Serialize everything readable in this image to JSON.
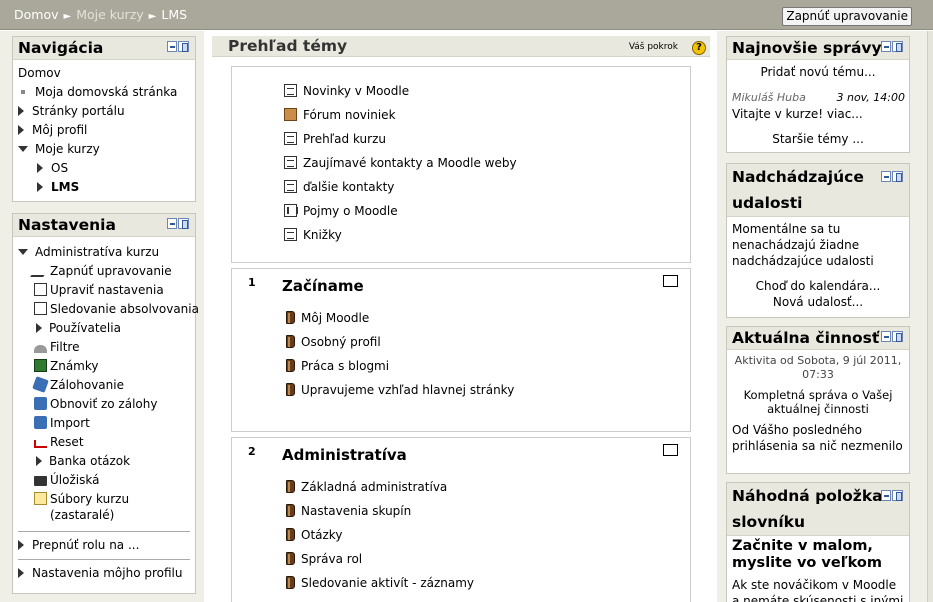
{
  "breadcrumb": {
    "home": "Domov",
    "my_courses": "Moje kurzy",
    "current": "LMS",
    "separator": "►"
  },
  "edit_button": "Zapnúť upravovanie",
  "navigation": {
    "title": "Navigácia",
    "items": [
      {
        "label": "Domov",
        "bullet": "none",
        "indent": 0,
        "bold": false
      },
      {
        "label": "Moja domovská stránka",
        "bullet": "square",
        "indent": 0,
        "bold": false
      },
      {
        "label": "Stránky portálu",
        "bullet": "collapsed",
        "indent": 0,
        "bold": false
      },
      {
        "label": "Môj profil",
        "bullet": "collapsed",
        "indent": 0,
        "bold": false
      },
      {
        "label": "Moje kurzy",
        "bullet": "expanded",
        "indent": 0,
        "bold": false
      },
      {
        "label": "OS",
        "bullet": "collapsed",
        "indent": 1,
        "bold": false
      },
      {
        "label": "LMS",
        "bullet": "collapsed",
        "indent": 1,
        "bold": true
      }
    ]
  },
  "settings": {
    "title": "Nastavenia",
    "admin_title": "Administratíva kurzu",
    "items": [
      {
        "label": "Zapnúť upravovanie",
        "icon": "edit-icon"
      },
      {
        "label": "Upraviť nastavenia",
        "icon": "settings-doc-icon"
      },
      {
        "label": "Sledovanie absolvovania",
        "icon": "completion-doc-icon"
      },
      {
        "label": "Používatelia",
        "icon": "collapsed"
      },
      {
        "label": "Filtre",
        "icon": "filter-icon"
      },
      {
        "label": "Známky",
        "icon": "grades-icon"
      },
      {
        "label": "Zálohovanie",
        "icon": "backup-icon"
      },
      {
        "label": "Obnoviť zo zálohy",
        "icon": "restore-icon"
      },
      {
        "label": "Import",
        "icon": "import-icon"
      },
      {
        "label": "Reset",
        "icon": "reset-icon"
      },
      {
        "label": "Banka otázok",
        "icon": "collapsed"
      },
      {
        "label": "Úložiská",
        "icon": "repository-icon"
      },
      {
        "label": "Súbory kurzu",
        "icon": "folder-icon"
      },
      {
        "label": "(zastaralé)",
        "icon": "none"
      }
    ],
    "switch_role": "Prepnúť rolu na ...",
    "profile_settings": "Nastavenia môjho profilu"
  },
  "main": {
    "title": "Prehľad témy",
    "progress_label": "Váš pokrok",
    "help_glyph": "?",
    "section0": [
      {
        "label": "Novinky v Moodle",
        "icon": "doc"
      },
      {
        "label": "Fórum noviniek",
        "icon": "forum"
      },
      {
        "label": "Prehľad kurzu",
        "icon": "doc"
      },
      {
        "label": "Zaujímavé kontakty a Moodle weby",
        "icon": "doc"
      },
      {
        "label": "ďalšie kontakty",
        "icon": "doc"
      },
      {
        "label": "Pojmy o Moodle",
        "icon": "glossary"
      },
      {
        "label": "Knižky",
        "icon": "doc"
      }
    ],
    "section1": {
      "number": "1",
      "title": "Začíname",
      "items": [
        "Môj Moodle",
        "Osobný profil",
        "Práca s blogmi",
        "Upravujeme vzhľad hlavnej stránky"
      ]
    },
    "section2": {
      "number": "2",
      "title": "Administratíva",
      "items": [
        "Základná administratíva",
        "Nastavenia skupín",
        "Otázky",
        "Správa rol",
        "Sledovanie aktivít - záznamy"
      ]
    }
  },
  "news": {
    "title": "Najnovšie správy",
    "add_topic": "Pridať novú tému...",
    "author": "Mikuláš Huba",
    "date": "3 nov, 14:00",
    "post": "Vitajte v kurze! viac...",
    "older": "Staršie témy ..."
  },
  "events": {
    "title_line1": "Nadchádzajúce",
    "title_line2": "udalosti",
    "text": "Momentálne sa tu nenachádzajú žiadne nadchádzajúce udalosti",
    "calendar_link": "Choď do kalendára...",
    "new_event": "Nová udalosť..."
  },
  "activity": {
    "title": "Aktuálna činnosť",
    "since": "Aktivita od Sobota, 9 júl 2011, 07:33",
    "full_report": "Kompletná správa o Vašej aktuálnej činnosti",
    "nothing": "Od Vášho posledného prihlásenia sa nič nezmenilo"
  },
  "glossary": {
    "title_line1": "Náhodná položka",
    "title_line2": "slovníku",
    "entry_title": "Začnite v malom, myslite vo veľkom",
    "entry_text": "Ak ste nováčikom v Moodle a nemáte skúsenosti s inými e-"
  }
}
